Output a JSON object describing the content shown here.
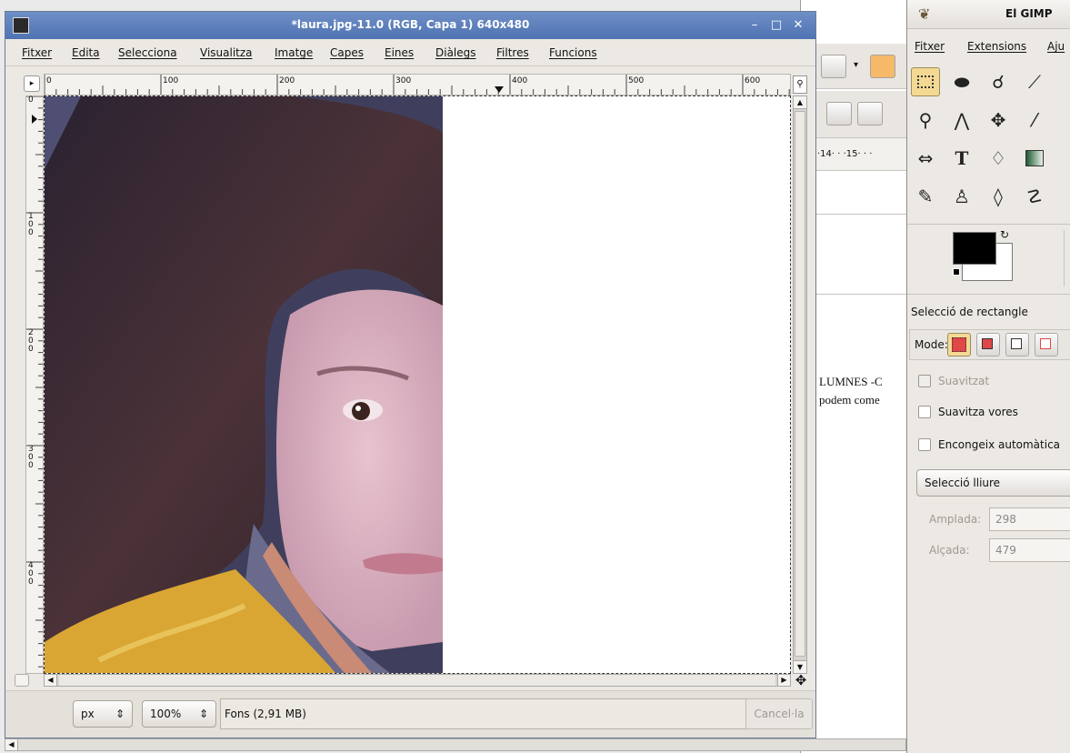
{
  "image_window": {
    "title": "*laura.jpg-11.0 (RGB, Capa 1) 640x480",
    "menu": [
      "Fitxer",
      "Edita",
      "Selecciona",
      "Visualitza",
      "Imatge",
      "Capes",
      "Eines",
      "Diàlegs",
      "Filtres",
      "Funcions"
    ],
    "hruler_labels": [
      "0",
      "100",
      "200",
      "300",
      "400",
      "500",
      "600"
    ],
    "vruler_labels": [
      "0",
      "1\n0\n0",
      "2\n0\n0",
      "3\n0\n0",
      "4\n0\n0"
    ],
    "unit": "px",
    "zoom": "100%",
    "status": "Fons (2,91 MB)",
    "cancel_label": "Cancel·la"
  },
  "background_doc": {
    "ruler_text": "·14· · ·15· · ·",
    "text_line1": "LUMNES -C",
    "text_line2": "podem come"
  },
  "toolbox": {
    "title": "El GIMP",
    "menu": [
      "Fitxer",
      "Extensions",
      "Aju"
    ],
    "tools": [
      "rect-select",
      "ellipse-select",
      "lasso",
      "fuzzy-select",
      "magnify",
      "paths",
      "move",
      "brush",
      "flip",
      "text",
      "bucket-fill",
      "gradient",
      "pencil",
      "clone",
      "ink",
      "smudge"
    ],
    "options_title": "Selecció de rectangle",
    "mode_label": "Mode:",
    "antialias_label": "Suavitzat",
    "feather_label": "Suavitza vores",
    "autoshrink_label": "Encongeix automàtica",
    "fixed_select": "Selecció lliure",
    "width_label": "Amplada:",
    "width_value": "298",
    "height_label": "Alçada:",
    "height_value": "479",
    "fg_color": "#000000",
    "bg_color": "#ffffff"
  }
}
